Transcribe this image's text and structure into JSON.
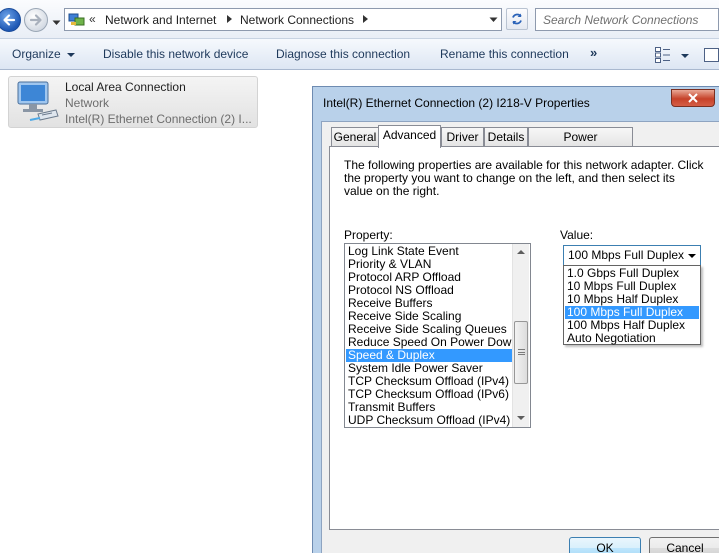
{
  "address_bar": {
    "breadcrumbs": [
      "Network and Internet",
      "Network Connections"
    ],
    "search_placeholder": "Search Network Connections"
  },
  "toolbar": {
    "organize_label": "Organize",
    "disable_label": "Disable this network device",
    "diagnose_label": "Diagnose this connection",
    "rename_label": "Rename this connection",
    "more_label": "»"
  },
  "connection": {
    "name": "Local Area Connection",
    "status": "Network",
    "device": "Intel(R) Ethernet Connection (2) I..."
  },
  "dialog": {
    "title": "Intel(R) Ethernet Connection (2) I218-V Properties",
    "tabs": [
      {
        "label": "General"
      },
      {
        "label": "Advanced"
      },
      {
        "label": "Driver"
      },
      {
        "label": "Details"
      },
      {
        "label": "Power Management"
      }
    ],
    "active_tab": "Advanced",
    "description": "The following properties are available for this network adapter. Click the property you want to change on the left, and then select its value on the right.",
    "property_label": "Property:",
    "value_label": "Value:",
    "properties": [
      "Log Link State Event",
      "Priority & VLAN",
      "Protocol ARP Offload",
      "Protocol NS Offload",
      "Receive Buffers",
      "Receive Side Scaling",
      "Receive Side Scaling Queues",
      "Reduce Speed On Power Down",
      "Speed & Duplex",
      "System Idle Power Saver",
      "TCP Checksum Offload (IPv4)",
      "TCP Checksum Offload (IPv6)",
      "Transmit Buffers",
      "UDP Checksum Offload (IPv4)"
    ],
    "selected_property": "Speed & Duplex",
    "value_current": "100 Mbps Full Duplex",
    "value_options": [
      "1.0 Gbps Full Duplex",
      "10 Mbps Full Duplex",
      "10 Mbps Half Duplex",
      "100 Mbps Full Duplex",
      "100 Mbps Half Duplex",
      "Auto Negotiation"
    ],
    "highlighted_option": "100 Mbps Full Duplex",
    "ok_label": "OK",
    "cancel_label": "Cancel"
  },
  "colors": {
    "selection": "#3399ff",
    "dialog_frame": "#b9d1ea",
    "close_button": "#c6422a",
    "toolbar_text": "#1e395b"
  }
}
